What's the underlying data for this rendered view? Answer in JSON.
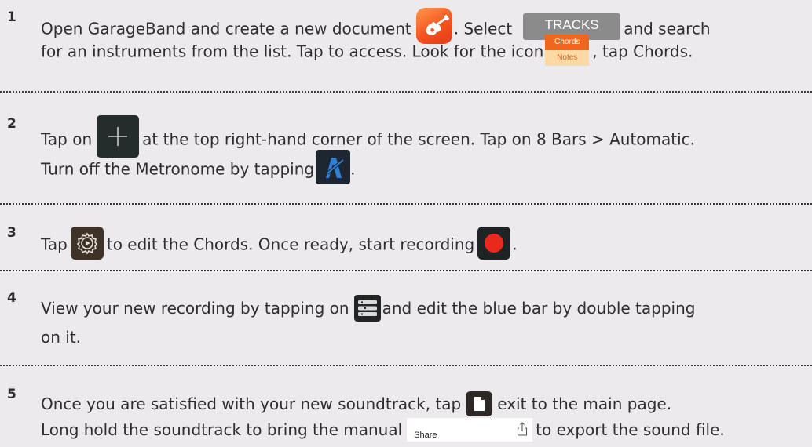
{
  "steps": [
    {
      "number": "1",
      "line1": {
        "t1": "Open GarageBand and create a new document",
        "t2": ". Select",
        "t3": "and search"
      },
      "line2": {
        "t1": "for an instruments from the list. Tap to access. Look for the icon",
        "t2": ", tap Chords."
      }
    },
    {
      "number": "2",
      "line1": {
        "t1": "Tap on",
        "t2": "at the top right-hand corner of the screen. Tap on 8 Bars > Automatic."
      },
      "line2": {
        "t1": "Turn off the Metronome by tapping",
        "t2": "."
      }
    },
    {
      "number": "3",
      "line1": {
        "t1": "Tap",
        "t2": "to edit the Chords.  Once ready, start recording",
        "t3": "."
      }
    },
    {
      "number": "4",
      "line1": {
        "t1": "View your new recording by tapping on",
        "t2": "and edit the blue bar by double tapping"
      },
      "line2": {
        "t1": "on it."
      }
    },
    {
      "number": "5",
      "line1": {
        "t1": "Once you are satisfied with your new soundtrack, tap",
        "t2": "exit to the main page."
      },
      "line2": {
        "t1": "Long hold the soundtrack to bring the manual",
        "t2": "to export the sound file."
      }
    }
  ],
  "ui": {
    "tracks_button": "TRACKS",
    "chords_label": "Chords",
    "notes_label": "Notes",
    "share_label": "Share"
  },
  "icons": {
    "app": "garageband-app-icon",
    "add": "plus-icon",
    "metronome": "metronome-icon",
    "settings": "gear-icon",
    "record": "record-icon",
    "tracks_view": "tracks-view-icon",
    "my_songs": "document-icon",
    "share": "share-icon"
  },
  "colors": {
    "background": "#eceaec",
    "tracks_button": "#8b8b8b",
    "chords_orange": "#f1661f",
    "notes_peach": "#fbd9a4",
    "record_red": "#e8291c",
    "metronome_blue": "#2f7fd6"
  }
}
